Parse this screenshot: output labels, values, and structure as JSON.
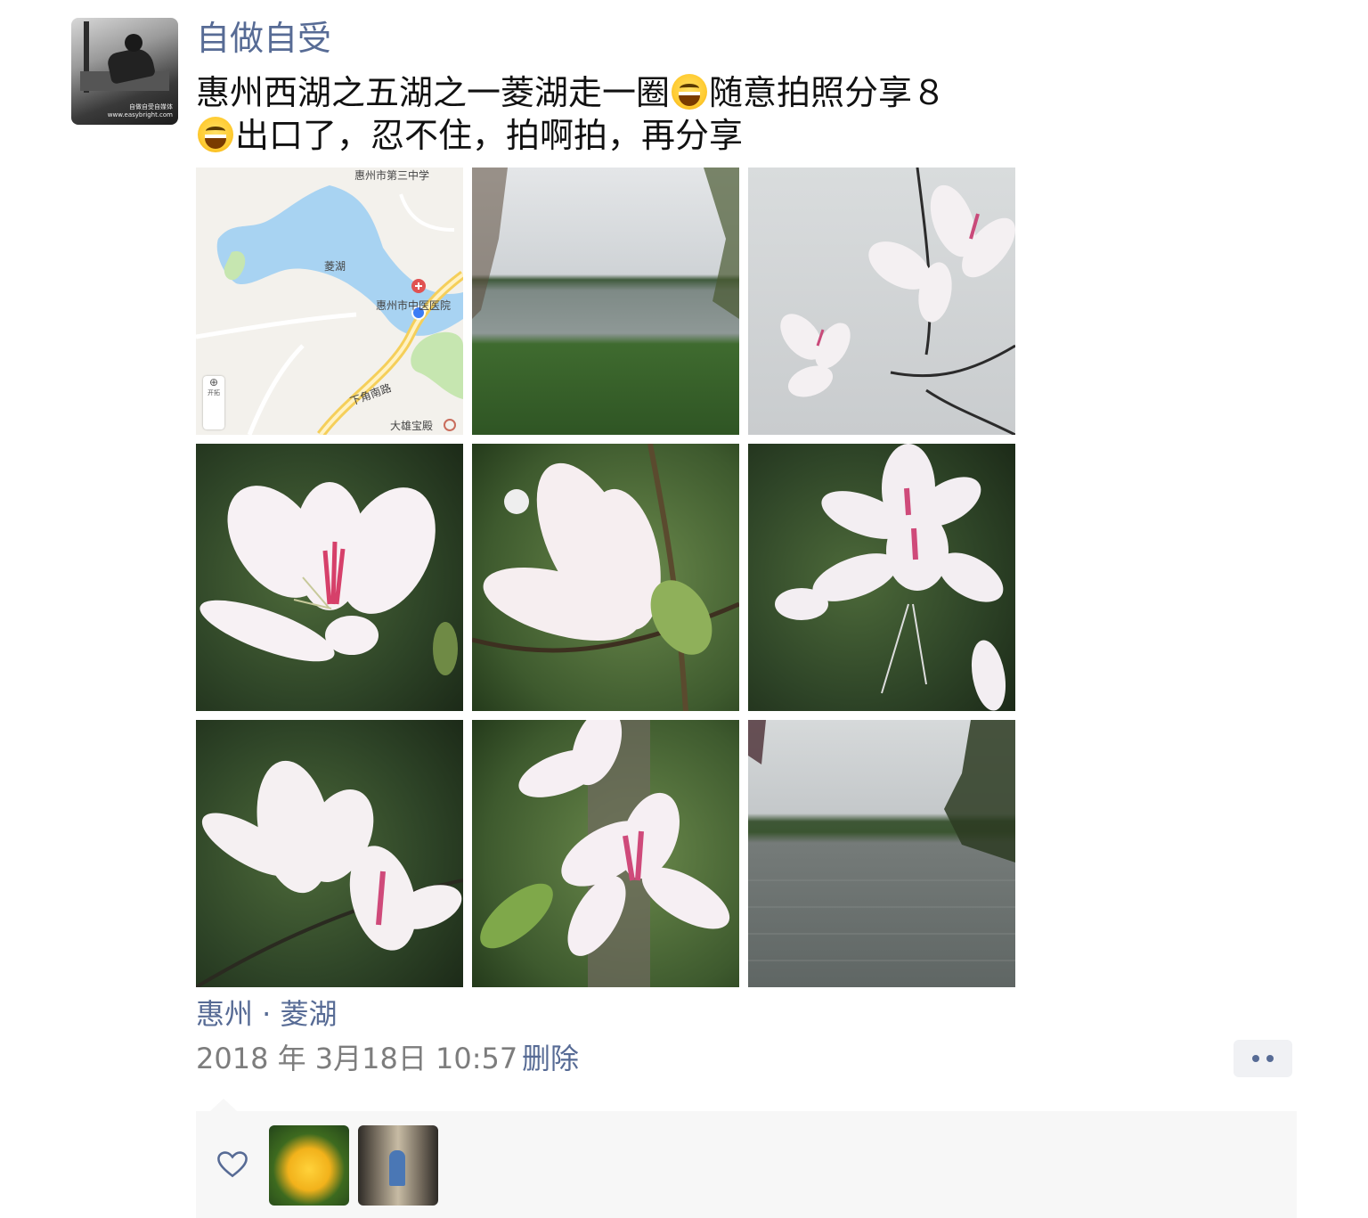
{
  "author": {
    "username": "自做自受",
    "avatar_caption": "自做自受自媒体 www.easybright.com"
  },
  "post": {
    "line1_part1": "惠州西湖之五湖之一菱湖走一圈",
    "line1_part2": "随意拍照分享８",
    "line2": "出口了，忍不住，拍啊拍，再分享",
    "emoji_name": "grinning-face-emoji"
  },
  "photos": {
    "count": 9,
    "map": {
      "label_school": "惠州市第三中学",
      "label_lake": "菱湖",
      "label_hospital": "惠州市中医医院",
      "label_road": "下角南路",
      "label_temple": "大雄宝殿",
      "label_zoom": "开拓"
    }
  },
  "location": "惠州 · 菱湖",
  "timestamp": "2018 年 3月18日 10:57",
  "delete_label": "删除",
  "colors": {
    "link": "#576b95",
    "meta": "#7d7d7d",
    "likes_bg": "#f7f7f7"
  },
  "likes": {
    "icon": "heart-outline-icon",
    "count": 2
  }
}
